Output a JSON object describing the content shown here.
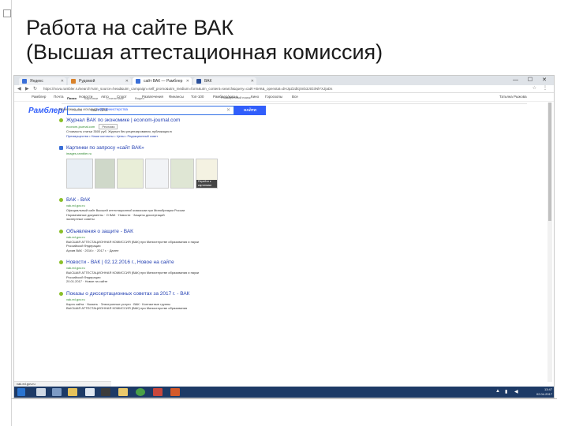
{
  "slide": {
    "title_line1": "Работа на сайте ВАК",
    "title_line2": "(Высшая аттестационная комиссия)"
  },
  "browser": {
    "tabs": [
      {
        "label": "Яндекс"
      },
      {
        "label": "Рудомой"
      },
      {
        "label": "сайт ВАК — Рамблер",
        "active": true
      },
      {
        "label": "ВАК"
      }
    ],
    "url": "https://nova.rambler.ru/search?utm_source=head&utm_campaign=self_promo&utm_medium=form&utm_content=search&query=сайт+ВАК&_openstat=dHJpZ2dlcjtmb3JtO3NlYXJjaDs",
    "window_controls": "— ☐ ✕"
  },
  "topnav": {
    "items": [
      "Рамблер",
      "Почта",
      "Новости",
      "Авто",
      "Спорт",
      "Развлечения",
      "Финансы",
      "Топ-100",
      "Рамблер/жизнь",
      "Кино",
      "Гороскопы",
      "Все"
    ],
    "user": "Татьяна Рыжова"
  },
  "search": {
    "logo": "Рамблер/",
    "query_prefix": "поиск",
    "query": "сайт ВАК",
    "button": "НАЙТИ",
    "extended": "Расширенный поиск",
    "verticals": [
      "Поиск",
      "Картинки",
      "Статистика",
      "Видео"
    ]
  },
  "results": {
    "note": "Возможно, вы искали:",
    "note_link": "сайт министерства",
    "items": [
      {
        "title": "Журнал ВАК по экономике | econom-journal.com",
        "url": "econom-journal.com",
        "badge": "Реклама",
        "snippet1": "Стоимость статьи 3500 руб. Журнал без рецензирования, публикация в",
        "snippet2": "Преимущества  •  Наши контакты  •  Цены  •  Редакционный совет"
      },
      {
        "title": "Картинки по запросу «сайт ВАК»",
        "url": "images.rambler.ru",
        "is_images": true,
        "thumb_caption": "Перейти к картинкам"
      },
      {
        "title": "ВАК - ВАК",
        "url": "vak.ed.gov.ru",
        "snippet1": "Официальный сайт Высшей аттестационной комиссии при Минобрнауки России",
        "snippet2": "Нормативные документы · О ВАК · Новости · Защиты диссертаций",
        "snippet3": "экспертные советы"
      },
      {
        "title": "Объявления о защите - ВАК",
        "url": "vak.ed.gov.ru",
        "snippet1": "ВЫСШАЯ АТТЕСТАЦИОННАЯ КОМИССИЯ (ВАК) при Министерстве образования и науки",
        "snippet2": "Российской Федерации",
        "snippet3": "Архив ВАК · 2016 г. · 2017 г. · Далее"
      },
      {
        "title": "Новости - ВАК | 02.12.2016 г., Новое на сайте",
        "url": "vak.ed.gov.ru",
        "snippet1": "ВЫСШАЯ АТТЕСТАЦИОННАЯ КОМИССИЯ (ВАК) при Министерстве образования и науки",
        "snippet2": "Российской Федерации",
        "snippet3": "20.01.2017 · Новое на сайте"
      },
      {
        "title": "Показы о диссертационных советах за 2017 г. - ВАК",
        "url": "vak.ed.gov.ru",
        "snippet1": "Карта сайта · Указать · Электронные услуги · ВАК · Контактные группы",
        "snippet2": "ВЫСШАЯ АТТЕСТАЦИОННАЯ КОМИССИЯ (ВАК) при Министерстве образования"
      }
    ]
  },
  "status": {
    "text": "vak.ed.gov.ru"
  },
  "taskbar": {
    "time": "13:47",
    "date": "02.04.2017"
  },
  "colors": {
    "accent": "#315efb",
    "link": "#2440b3",
    "url_green": "#2f8a2f",
    "taskbar": "#1d3a66"
  }
}
